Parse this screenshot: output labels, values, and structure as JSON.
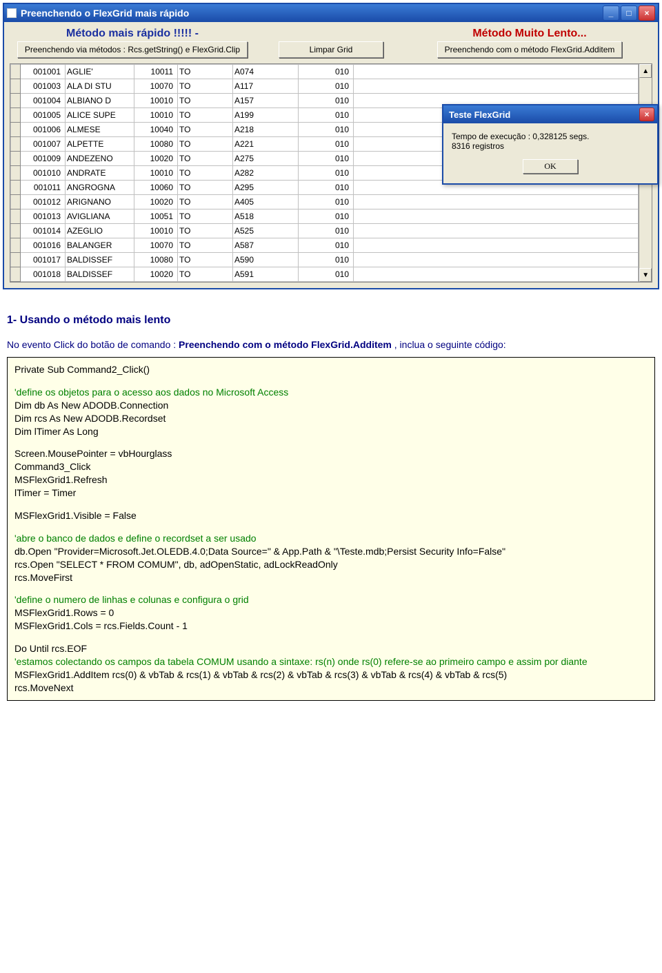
{
  "window": {
    "title": "Preenchendo o FlexGrid mais rápido"
  },
  "buttons": {
    "fast_title": "Método mais rápido !!!!! -",
    "fast_btn": "Preenchendo via métodos : Rcs.getString() e FlexGrid.Clip",
    "clear_btn": "Limpar Grid",
    "slow_title": "Método Muito Lento...",
    "slow_btn": "Preenchendo com o método FlexGrid.Additem"
  },
  "grid_rows": [
    {
      "c1": "001001",
      "c2": "AGLIE'",
      "c3": "10011",
      "c4": "TO",
      "c5": "A074",
      "c6": "010"
    },
    {
      "c1": "001003",
      "c2": "ALA DI STU",
      "c3": "10070",
      "c4": "TO",
      "c5": "A117",
      "c6": "010"
    },
    {
      "c1": "001004",
      "c2": "ALBIANO D",
      "c3": "10010",
      "c4": "TO",
      "c5": "A157",
      "c6": "010"
    },
    {
      "c1": "001005",
      "c2": "ALICE SUPE",
      "c3": "10010",
      "c4": "TO",
      "c5": "A199",
      "c6": "010"
    },
    {
      "c1": "001006",
      "c2": "ALMESE",
      "c3": "10040",
      "c4": "TO",
      "c5": "A218",
      "c6": "010"
    },
    {
      "c1": "001007",
      "c2": "ALPETTE",
      "c3": "10080",
      "c4": "TO",
      "c5": "A221",
      "c6": "010"
    },
    {
      "c1": "001009",
      "c2": "ANDEZENO",
      "c3": "10020",
      "c4": "TO",
      "c5": "A275",
      "c6": "010"
    },
    {
      "c1": "001010",
      "c2": "ANDRATE",
      "c3": "10010",
      "c4": "TO",
      "c5": "A282",
      "c6": "010"
    },
    {
      "c1": "001011",
      "c2": "ANGROGNA",
      "c3": "10060",
      "c4": "TO",
      "c5": "A295",
      "c6": "010"
    },
    {
      "c1": "001012",
      "c2": "ARIGNANO",
      "c3": "10020",
      "c4": "TO",
      "c5": "A405",
      "c6": "010"
    },
    {
      "c1": "001013",
      "c2": "AVIGLIANA",
      "c3": "10051",
      "c4": "TO",
      "c5": "A518",
      "c6": "010"
    },
    {
      "c1": "001014",
      "c2": "AZEGLIO",
      "c3": "10010",
      "c4": "TO",
      "c5": "A525",
      "c6": "010"
    },
    {
      "c1": "001016",
      "c2": "BALANGER",
      "c3": "10070",
      "c4": "TO",
      "c5": "A587",
      "c6": "010"
    },
    {
      "c1": "001017",
      "c2": "BALDISSEF",
      "c3": "10080",
      "c4": "TO",
      "c5": "A590",
      "c6": "010"
    },
    {
      "c1": "001018",
      "c2": "BALDISSEF",
      "c3": "10020",
      "c4": "TO",
      "c5": "A591",
      "c6": "010"
    }
  ],
  "dialog": {
    "title": "Teste FlexGrid",
    "line1": "Tempo de execução : 0,328125 segs.",
    "line2": "8316 registros",
    "ok": "OK"
  },
  "article": {
    "h3": "1- Usando o método mais lento",
    "p1_a": "No evento Click do botão de comando : ",
    "p1_b": "Preenchendo com o método FlexGrid.Additem",
    "p1_c": " , inclua o seguinte código:"
  },
  "code": {
    "l1": "Private Sub Command2_Click()",
    "c1": "'define os objetos para o acesso aos dados no Microsoft Access",
    "l2": "Dim db As New ADODB.Connection",
    "l3": "Dim rcs As New ADODB.Recordset",
    "l4": "Dim lTimer As Long",
    "l5": "Screen.MousePointer = vbHourglass",
    "l6": "Command3_Click",
    "l7": "MSFlexGrid1.Refresh",
    "l8": "lTimer = Timer",
    "l9": "MSFlexGrid1.Visible = False",
    "c2": "'abre o banco de dados e define o recordset a ser usado",
    "l10": "db.Open \"Provider=Microsoft.Jet.OLEDB.4.0;Data Source=\" & App.Path & \"\\Teste.mdb;Persist Security Info=False\"",
    "l11": "rcs.Open \"SELECT * FROM COMUM\", db, adOpenStatic, adLockReadOnly",
    "l12": "rcs.MoveFirst",
    "c3": "'define o numero de linhas e colunas e configura o grid",
    "l13": "MSFlexGrid1.Rows = 0",
    "l14": "MSFlexGrid1.Cols = rcs.Fields.Count - 1",
    "l15": "Do Until rcs.EOF",
    "c4": "'estamos colectando os campos da tabela COMUM usando a sintaxe: rs(n) onde rs(0) refere-se ao primeiro campo e assim por diante",
    "l16": "MSFlexGrid1.AddItem rcs(0) & vbTab & rcs(1) & vbTab & rcs(2) & vbTab & rcs(3) & vbTab & rcs(4) & vbTab & rcs(5)",
    "l17": "rcs.MoveNext"
  }
}
